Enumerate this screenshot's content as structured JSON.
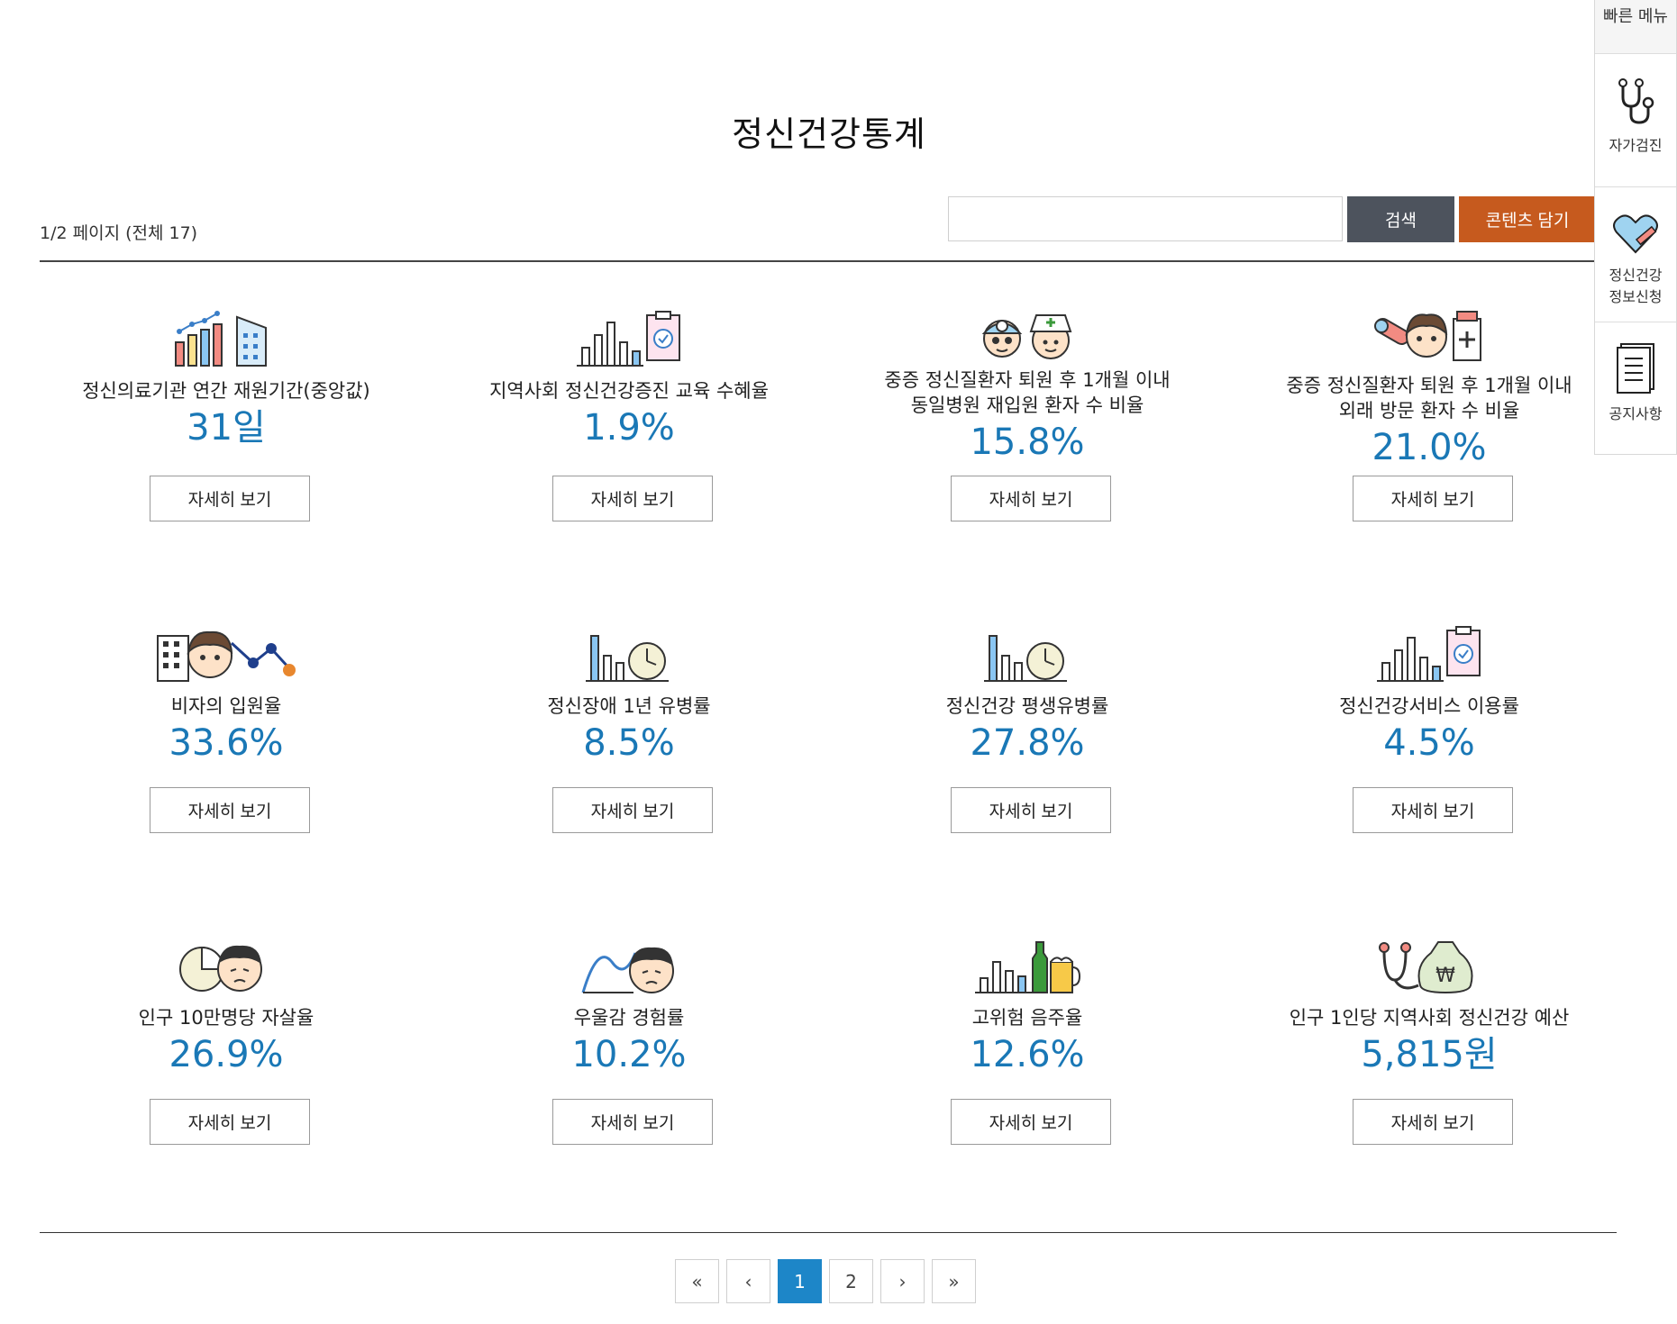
{
  "header": {
    "title": "정신건강통계",
    "page_info": "1/2 페이지 (전체 17)"
  },
  "search": {
    "placeholder": "",
    "button_label": "검색",
    "contents_button_label": "콘텐츠 담기"
  },
  "cards": [
    {
      "title": "정신의료기관 연간 재원기간(중앙값)",
      "value": "31일",
      "button": "자세히 보기",
      "icon": "bar-building-icon"
    },
    {
      "title": "지역사회 정신건강증진 교육 수혜율",
      "value": "1.9%",
      "button": "자세히 보기",
      "icon": "bar-clipboard-icon"
    },
    {
      "title": "중증 정신질환자 퇴원 후 1개월 이내\n동일병원 재입원 환자 수 비율",
      "value": "15.8%",
      "button": "자세히 보기",
      "icon": "doctor-nurse-icon"
    },
    {
      "title": "중증 정신질환자 퇴원 후 1개월 이내\n외래 방문 환자 수 비율",
      "value": "21.0%",
      "button": "자세히 보기",
      "icon": "pill-patient-icon"
    },
    {
      "title": "비자의 입원율",
      "value": "33.6%",
      "button": "자세히 보기",
      "icon": "building-person-icon"
    },
    {
      "title": "정신장애 1년 유병률",
      "value": "8.5%",
      "button": "자세히 보기",
      "icon": "bar-clock-icon"
    },
    {
      "title": "정신건강 평생유병률",
      "value": "27.8%",
      "button": "자세히 보기",
      "icon": "bar-clock-icon"
    },
    {
      "title": "정신건강서비스 이용률",
      "value": "4.5%",
      "button": "자세히 보기",
      "icon": "bar-clipboard-icon"
    },
    {
      "title": "인구 10만명당 자살율",
      "value": "26.9%",
      "button": "자세히 보기",
      "icon": "pie-sad-face-icon"
    },
    {
      "title": "우울감 경험률",
      "value": "10.2%",
      "button": "자세히 보기",
      "icon": "wave-sad-face-icon"
    },
    {
      "title": "고위험 음주율",
      "value": "12.6%",
      "button": "자세히 보기",
      "icon": "bar-alcohol-icon"
    },
    {
      "title": "인구 1인당 지역사회 정신건강 예산",
      "value": "5,815원",
      "button": "자세히 보기",
      "icon": "stethoscope-moneybag-icon"
    }
  ],
  "quick_menu": {
    "title": "빠른 메뉴",
    "items": [
      {
        "label": "자가검진",
        "icon": "stethoscope-icon"
      },
      {
        "label": "정신건강\n정보신청",
        "icon": "heart-pencil-icon"
      },
      {
        "label": "공지사항",
        "icon": "notice-list-icon"
      }
    ]
  },
  "pagination": {
    "first": "«",
    "prev": "‹",
    "pages": [
      "1",
      "2"
    ],
    "current": "1",
    "next": "›",
    "last": "»"
  },
  "colors": {
    "value_blue": "#1a78b6",
    "search_gray": "#4d535d",
    "contents_orange": "#c65a1e",
    "page_active": "#1d86c8"
  }
}
